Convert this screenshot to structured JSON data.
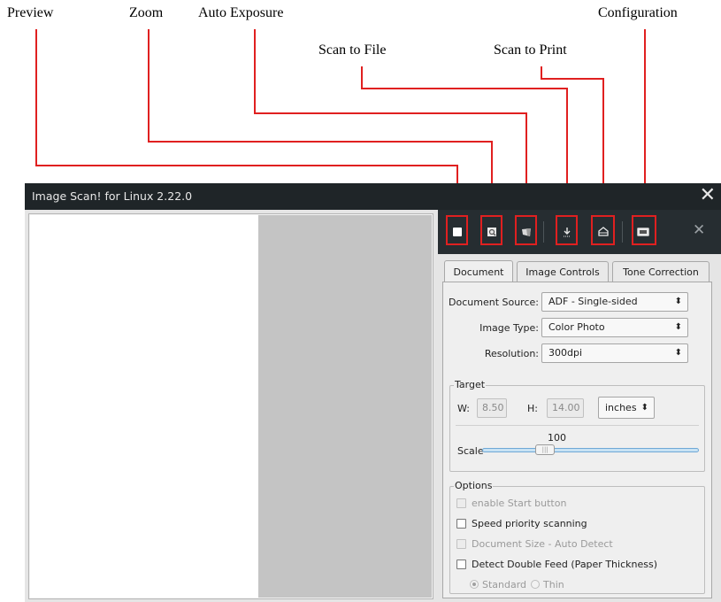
{
  "callouts": {
    "preview": "Preview",
    "zoom": "Zoom",
    "auto_exposure": "Auto Exposure",
    "scan_to_file": "Scan to File",
    "scan_to_print": "Scan to Print",
    "configuration": "Configuration"
  },
  "window": {
    "title": "Image Scan! for Linux 2.22.0",
    "close_glyph": "✕"
  },
  "toolbar": {
    "close_glyph": "✕",
    "icons": [
      "preview-icon",
      "zoom-icon",
      "auto-exposure-icon",
      "scan-to-file-icon",
      "scan-to-print-icon",
      "configuration-icon"
    ]
  },
  "tabs": [
    {
      "label": "Document",
      "active": true
    },
    {
      "label": "Image Controls",
      "active": false
    },
    {
      "label": "Tone Correction",
      "active": false
    }
  ],
  "document": {
    "source_label": "Document Source:",
    "source_value": "ADF - Single-sided",
    "image_type_label": "Image Type:",
    "image_type_value": "Color Photo",
    "resolution_label": "Resolution:",
    "resolution_value": "300dpi",
    "combo_arrow": "⬍"
  },
  "target": {
    "group_title": "Target",
    "w_label": "W:",
    "w_value": "8.50",
    "h_label": "H:",
    "h_value": "14.00",
    "units_value": "inches",
    "scale_label": "Scale",
    "scale_value": "100",
    "scale_level_percent": 27
  },
  "options": {
    "group_title": "Options",
    "enable_start": "enable Start button",
    "speed_priority": "Speed priority scanning",
    "doc_size_auto": "Document Size - Auto Detect",
    "double_feed": "Detect Double Feed (Paper Thickness)",
    "standard": "Standard",
    "thin": "Thin"
  },
  "colors": {
    "annotation": "#e02020",
    "titlebar": "#1f2528",
    "toolbar": "#262d31",
    "slider": "#6fa8d6"
  }
}
